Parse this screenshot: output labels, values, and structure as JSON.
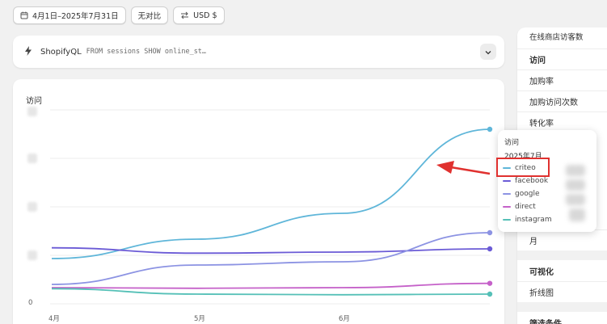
{
  "toolbar": {
    "date_range": "4月1日–2025年7月31日",
    "compare": "无对比",
    "currency": "USD $"
  },
  "query": {
    "brand": "ShopifyQL",
    "code": "FROM sessions SHOW online_st…"
  },
  "chart": {
    "title": "访问",
    "y_zero_label": "0",
    "x_labels": [
      "4月",
      "5月",
      "6月"
    ],
    "tooltip": {
      "title": "访问",
      "date": "2025年7月"
    }
  },
  "chart_data": {
    "type": "line",
    "title": "访问",
    "categories": [
      "4月",
      "5月",
      "6月",
      "7月"
    ],
    "series": [
      {
        "name": "criteo",
        "color": "#5fb6d9",
        "values": [
          210,
          300,
          420,
          810
        ]
      },
      {
        "name": "facebook",
        "color": "#6b5bd6",
        "values": [
          260,
          235,
          240,
          255
        ]
      },
      {
        "name": "google",
        "color": "#8c93e3",
        "values": [
          90,
          180,
          195,
          330
        ]
      },
      {
        "name": "direct",
        "color": "#c561c9",
        "values": [
          75,
          72,
          75,
          95
        ]
      },
      {
        "name": "instagram",
        "color": "#55c0b7",
        "values": [
          70,
          45,
          42,
          45
        ]
      }
    ],
    "ylim": [
      0,
      900
    ],
    "grid": true,
    "legend": "tooltip"
  },
  "right_panel": {
    "cut_top": "在线商店访客数",
    "metrics": [
      "访问",
      "加购率",
      "加购访问次数",
      "转化率"
    ],
    "partial": "月",
    "viz_heading": "可视化",
    "viz_value": "折线图",
    "filter_heading": "筛选条件"
  },
  "colors": {
    "highlight": "#e0312f",
    "background": "#f1f1f1"
  }
}
